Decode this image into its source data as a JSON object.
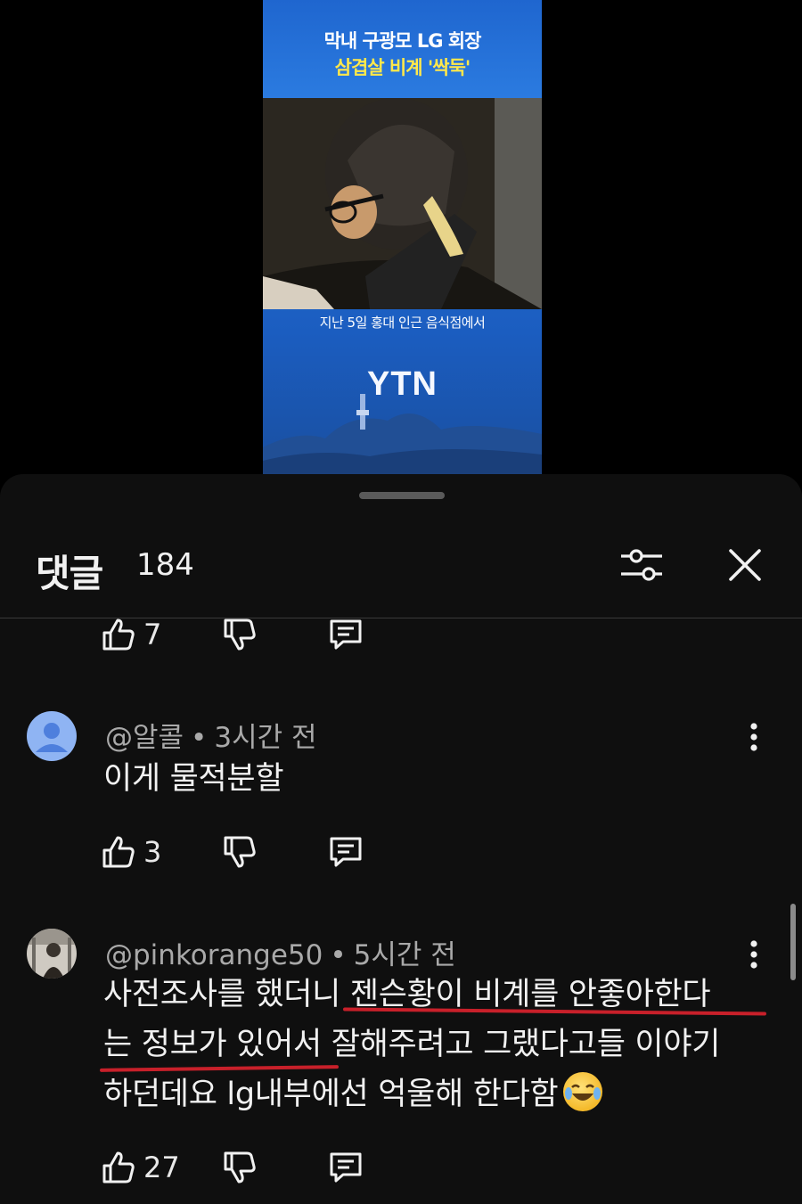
{
  "video": {
    "title_line1": "막내 구광모 LG 회장",
    "title_line2": "삼겹살 비계 '싹둑'",
    "caption": "지난 5일 홍대 인근 음식점에서",
    "logo": "YTN",
    "colors": {
      "banner": "#1f66cf",
      "highlight": "#ffe84a"
    }
  },
  "comments_sheet": {
    "title": "댓글",
    "count": "184",
    "sort_icon": "sliders-icon",
    "close_icon": "close-icon"
  },
  "comments": [
    {
      "partial": true,
      "likes": "7"
    },
    {
      "author": "@알콜",
      "time": "3시간 전",
      "text_lines": [
        "이게 물적분할"
      ],
      "likes": "3",
      "avatar": "default-person-avatar"
    },
    {
      "author": "@pinkorange50",
      "time": "5시간 전",
      "text_lines": [
        "사전조사를 했더니 젠슨황이 비계를 안좋아한다",
        "는 정보가 있어서 잘해주려고 그랬다고들 이야기",
        "하던데요 lg내부에선 억울해 한다함"
      ],
      "emoji": "tears-of-joy-emoji",
      "likes": "27",
      "avatar": "photo-avatar"
    }
  ],
  "separator": "•",
  "colors": {
    "sheet_bg": "#0f0f0f",
    "underline": "#c8202a",
    "meta": "#a9a9a9"
  }
}
